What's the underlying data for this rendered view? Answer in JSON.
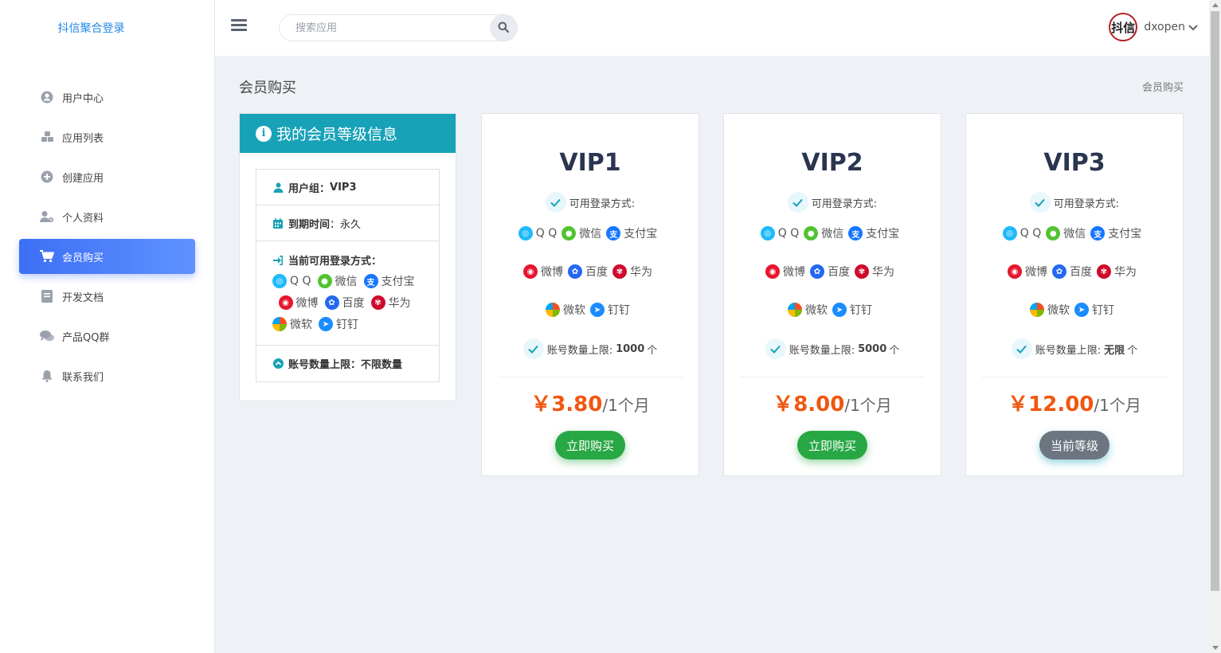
{
  "brand": "抖信聚合登录",
  "search": {
    "placeholder": "搜索应用"
  },
  "user": {
    "name": "dxopen",
    "avatar_text": "抖信"
  },
  "menu": [
    {
      "label": "用户中心",
      "icon": "user-circle-icon"
    },
    {
      "label": "应用列表",
      "icon": "cubes-icon"
    },
    {
      "label": "创建应用",
      "icon": "plus-circle-icon"
    },
    {
      "label": "个人资料",
      "icon": "user-cog-icon"
    },
    {
      "label": "会员购买",
      "icon": "cart-icon",
      "active": true
    },
    {
      "label": "开发文档",
      "icon": "book-icon"
    },
    {
      "label": "产品QQ群",
      "icon": "comments-icon"
    },
    {
      "label": "联系我们",
      "icon": "bell-icon"
    }
  ],
  "page": {
    "title": "会员购买",
    "breadcrumb": "会员购买"
  },
  "info": {
    "title": "我的会员等级信息",
    "group_label": "用户组：",
    "group_value": "VIP3",
    "expire_label": "到期时间",
    "expire_value": "：永久",
    "methods_label": "当前可用登录方式：",
    "limit_label": "账号数量上限：",
    "limit_value": "不限数量"
  },
  "methods": {
    "qq": "Q Q",
    "wechat": "微信",
    "alipay": "支付宝",
    "weibo": "微博",
    "baidu": "百度",
    "huawei": "华为",
    "microsoft": "微软",
    "dingtalk": "钉钉"
  },
  "plans": [
    {
      "name": "VIP1",
      "methods_label": "可用登录方式:",
      "limit_label": "账号数量上限:",
      "limit_value": "1000",
      "limit_unit": "个",
      "price": "￥3.80",
      "period": "/1个月",
      "button": "立即购买"
    },
    {
      "name": "VIP2",
      "methods_label": "可用登录方式:",
      "limit_label": "账号数量上限:",
      "limit_value": "5000",
      "limit_unit": "个",
      "price": "￥8.00",
      "period": "/1个月",
      "button": "立即购买"
    },
    {
      "name": "VIP3",
      "methods_label": "可用登录方式:",
      "limit_label": "账号数量上限:",
      "limit_value": "无限",
      "limit_unit": "个",
      "price": "￥12.00",
      "period": "/1个月",
      "button": "当前等级"
    }
  ],
  "colors": {
    "accent": "#3d6ff5",
    "info_header": "#17a2b8",
    "price": "#f0570f",
    "buy": "#28a745",
    "current": "#6c7580"
  }
}
